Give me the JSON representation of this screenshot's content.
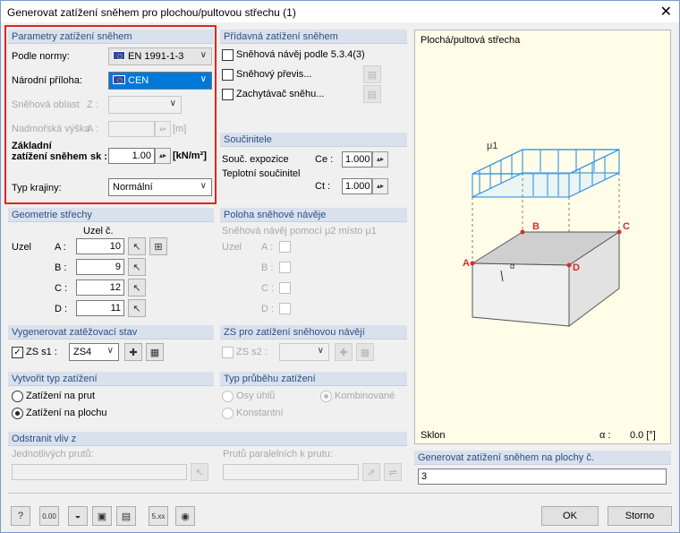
{
  "window": {
    "title": "Generovat zatížení sněhem pro plochou/pultovou střechu  (1)",
    "close": "✕"
  },
  "snow_params": {
    "header": "Parametry zatížení sněhem",
    "standard_label": "Podle normy:",
    "standard_value": "EN 1991-1-3",
    "annex_label": "Národní příloha:",
    "annex_value": "CEN",
    "zone_label": "Sněhová oblast",
    "zone_symbol": "Z :",
    "altitude_label": "Nadmořská výška",
    "altitude_symbol": "A :",
    "altitude_unit": "[m]",
    "base_label_1": "Základní",
    "base_label_2": "zatížení sněhem",
    "base_symbol": "sk :",
    "base_value": "1.00",
    "base_unit": "[kN/m²]",
    "terrain_label": "Typ krajiny:",
    "terrain_value": "Normální"
  },
  "additional": {
    "header": "Přídavná zatížení sněhem",
    "drift_label": "Sněhová návěj podle 5.3.4(3)",
    "overhang_label": "Sněhový převis...",
    "guard_label": "Zachytávač sněhu..."
  },
  "coefficients": {
    "header": "Součinitele",
    "exposure_label": "Souč. expozice",
    "exposure_symbol": "Ce :",
    "exposure_value": "1.000",
    "thermal_label": "Teplotní součinitel",
    "thermal_symbol": "Ct :",
    "thermal_value": "1.000"
  },
  "geometry": {
    "header": "Geometrie střechy",
    "col_header": "Uzel č.",
    "node_label": "Uzel",
    "rows": [
      {
        "label": "A :",
        "value": "10"
      },
      {
        "label": "B :",
        "value": "9"
      },
      {
        "label": "C :",
        "value": "12"
      },
      {
        "label": "D :",
        "value": "11"
      }
    ]
  },
  "drift_position": {
    "header": "Poloha sněhové návěje",
    "desc": "Sněhová návěj pomocí μ2 místo μ1",
    "node_label": "Uzel",
    "rows": [
      "A :",
      "B :",
      "C :",
      "D :"
    ]
  },
  "generate_lc": {
    "header": "Vygenerovat zatěžovací stav",
    "lc_label": "ZS s1 :",
    "lc_value": "ZS4"
  },
  "drift_lc": {
    "header": "ZS pro zatížení sněhovou návějí",
    "lc_label": "ZS s2 :"
  },
  "load_type": {
    "header": "Vytvořit typ zatížení",
    "member_label": "Zatížení na prut",
    "surface_label": "Zatížení na plochu"
  },
  "distribution": {
    "header": "Typ průběhu zatížení",
    "polygon_label": "Osy úhlů",
    "combined_label": "Kombinované",
    "constant_label": "Konstantní"
  },
  "remove": {
    "header": "Odstranit vliv z",
    "single_label": "Jednotlivých prutů:",
    "parallel_label": "Prutů paralelních k prutu:"
  },
  "preview": {
    "title": "Plochá/pultová střecha",
    "mu_label": "μ1",
    "node_a": "A",
    "node_b": "B",
    "node_c": "C",
    "node_d": "D",
    "alpha_symbol": "α",
    "slope_label": "Sklon",
    "slope_symbol": "α :",
    "slope_value": "0.0 [°]"
  },
  "generate_surfaces": {
    "header": "Generovat zatížení sněhem na plochy č.",
    "value": "3"
  },
  "footer": {
    "ok": "OK",
    "cancel": "Storno"
  },
  "colors": {
    "accent": "#0078d7",
    "highlight": "#e1261c",
    "load_arrows": "#1e88e5",
    "node_dot": "#d32f2f"
  }
}
